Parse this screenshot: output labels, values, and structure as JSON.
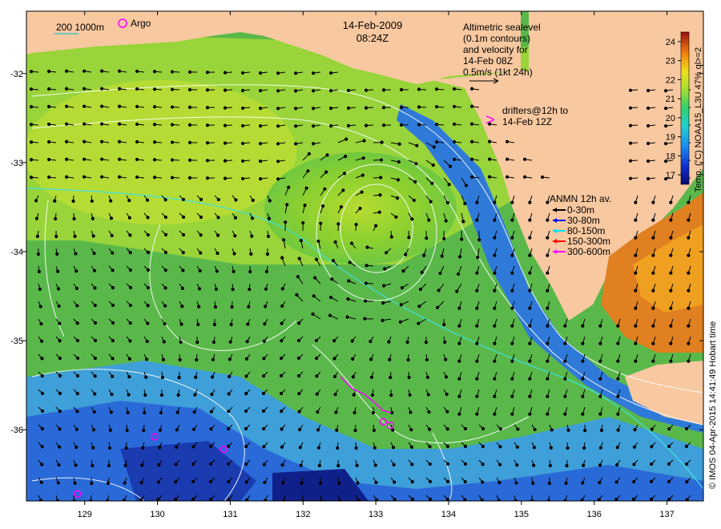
{
  "title": {
    "date": "14-Feb-2009",
    "time": "08:24Z"
  },
  "bathy_legend": {
    "contours": "200  1000m",
    "argo_label": "Argo"
  },
  "altimetry_note": {
    "lines": [
      "Altimetric sealevel",
      "(0.1m contours)",
      "and velocity for",
      "14-Feb 08Z",
      "0.5m/s (1kt 24h)"
    ]
  },
  "drifters_note": {
    "lines": [
      "drifters@12h to",
      "14-Feb 12Z"
    ],
    "symbol": ">"
  },
  "anmn": {
    "title": "ANMN 12h av.",
    "items": [
      {
        "label": "0-30m",
        "color": "#000000"
      },
      {
        "label": "30-80m",
        "color": "#0000ff"
      },
      {
        "label": "80-150m",
        "color": "#00e5ee"
      },
      {
        "label": "150-300m",
        "color": "#ff0000"
      },
      {
        "label": "300-600m",
        "color": "#ff00ff"
      }
    ]
  },
  "colorbar": {
    "label": "Temp. (°C) NOAA15_L3U 47% ql>=2",
    "ticks": [
      "17",
      "18",
      "19",
      "20",
      "21",
      "22",
      "23",
      "24"
    ],
    "min": 16.5,
    "max": 24.5
  },
  "axes": {
    "lon_ticks": [
      "129",
      "130",
      "131",
      "132",
      "133",
      "134",
      "135",
      "136",
      "137"
    ],
    "lat_ticks": [
      "-32",
      "-33",
      "-34",
      "-35",
      "-36"
    ]
  },
  "credit": "© IMOS 04-Apr-2015 14:41:49 Hobart time",
  "colors": {
    "land": "#f8c8a0",
    "sea_warm": "#a8d830",
    "sea_cool": "#4080e0",
    "drifter": "#ff00ff"
  },
  "map_data": {
    "lon_range": [
      128.2,
      137.5
    ],
    "lat_range": [
      -36.8,
      -31.3
    ],
    "argo_floats": [
      {
        "lon": 129.96,
        "lat": -36.08
      },
      {
        "lon": 130.91,
        "lat": -36.22
      },
      {
        "lon": 128.9,
        "lat": -36.72
      },
      {
        "lon": 133.2,
        "lat": -35.95
      },
      {
        "lon": 133.1,
        "lat": -35.91
      }
    ]
  }
}
